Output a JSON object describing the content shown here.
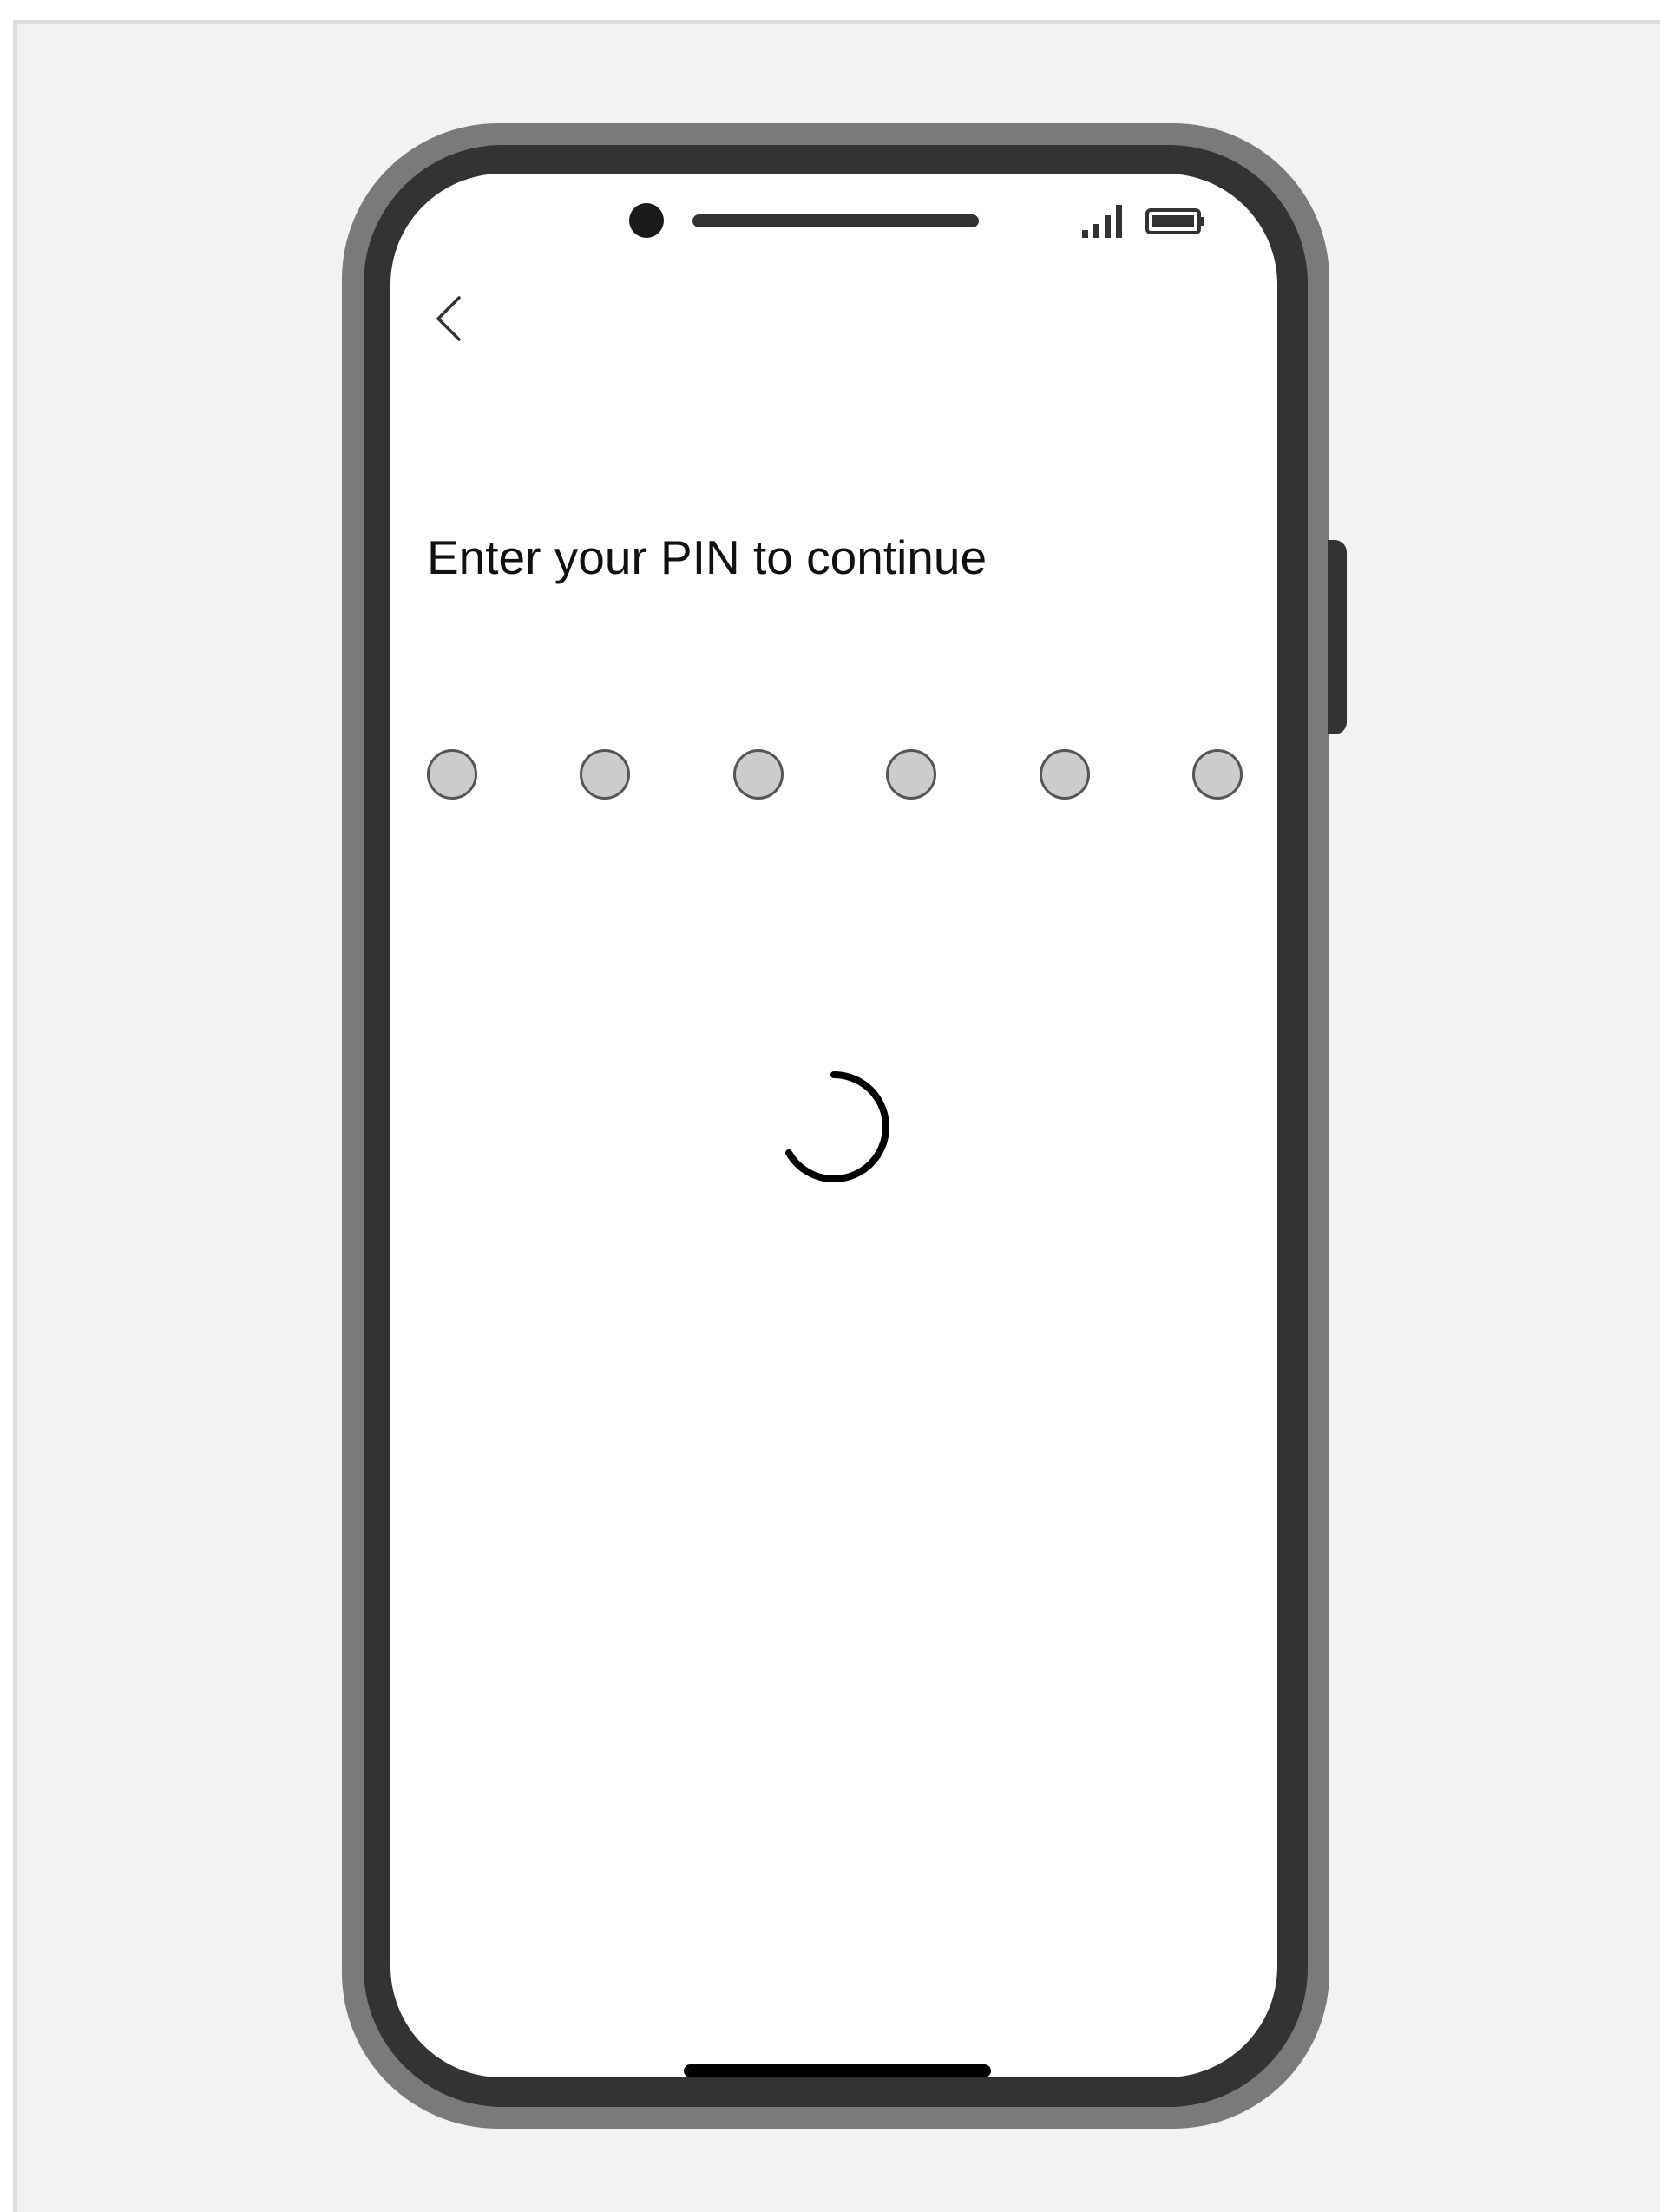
{
  "screen": {
    "title": "Enter your PIN to continue",
    "pin_length": 6,
    "pin_entered": 0,
    "loading": true
  },
  "icons": {
    "back": "chevron-left-icon",
    "signal": "signal-bars-icon",
    "battery": "battery-icon",
    "spinner": "loading-spinner-icon"
  },
  "colors": {
    "background": "#f2f2f2",
    "phone_frame": "#7a7a7a",
    "phone_bezel": "#333333",
    "screen": "#ffffff",
    "pin_dot_fill": "#cccccc",
    "pin_dot_border": "#555555",
    "text": "#111111"
  }
}
